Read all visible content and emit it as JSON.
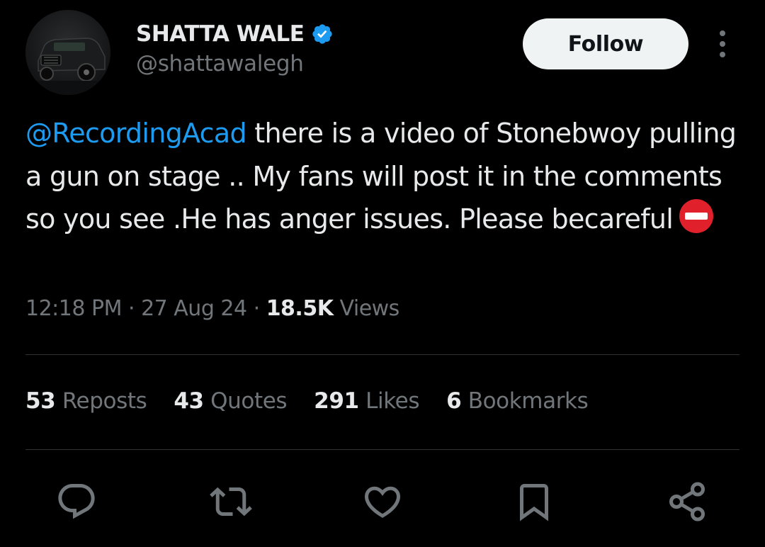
{
  "author": {
    "display_name": "SHATTA WALE",
    "handle": "@shattawalegh",
    "verified": true
  },
  "header": {
    "follow_label": "Follow",
    "more_icon": "more-vertical-icon"
  },
  "tweet": {
    "mention": "@RecordingAcad",
    "body": " there is a video of Stonebwoy pulling a gun on stage .. My fans will post it in the comments so you see .He has anger issues. Please becareful",
    "emoji": "no-entry-icon"
  },
  "meta": {
    "time": "12:18 PM",
    "sep1": " · ",
    "date": "27 Aug 24",
    "sep2": " · ",
    "views_count": "18.5K",
    "views_label": " Views"
  },
  "stats": [
    {
      "count": "53",
      "label": "Reposts"
    },
    {
      "count": "43",
      "label": "Quotes"
    },
    {
      "count": "291",
      "label": "Likes"
    },
    {
      "count": "6",
      "label": "Bookmarks"
    }
  ],
  "actions": [
    "reply-icon",
    "repost-icon",
    "like-icon",
    "bookmark-icon",
    "share-icon"
  ],
  "colors": {
    "background": "#000000",
    "text": "#e7e9ea",
    "muted": "#71767b",
    "accent": "#1d9bf0",
    "follow_bg": "#eff3f4",
    "no_entry_red": "#e0202a"
  }
}
